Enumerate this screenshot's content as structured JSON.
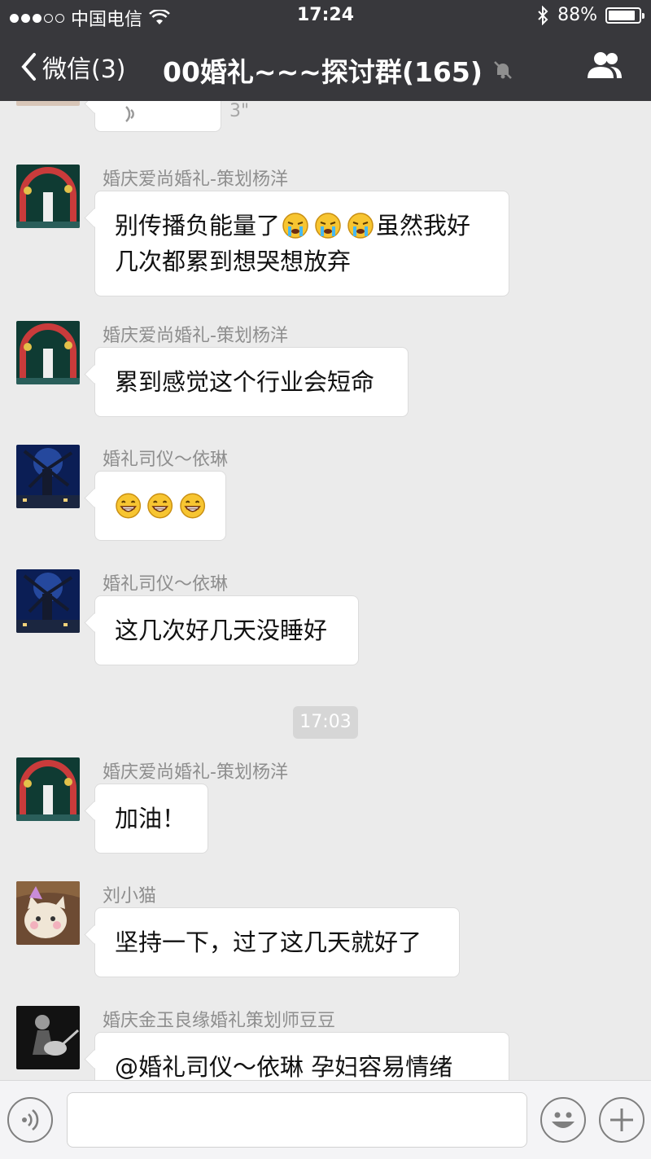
{
  "status": {
    "carrier": "中国电信",
    "time": "17:24",
    "battery": "88%",
    "battery_level": 0.88
  },
  "nav": {
    "back_label": "微信(3)",
    "title": "00婚礼~~~探讨群(165)"
  },
  "partial_voice_message": {
    "duration": "3\""
  },
  "messages": [
    {
      "sender": "婚庆爱尚婚礼-策划杨洋",
      "text_before": "别传播负能量了",
      "emoji": [
        "crying-face-icon",
        "crying-face-icon",
        "crying-face-icon"
      ],
      "text_after": "虽然我好",
      "line2": "几次都累到想哭想放弃"
    },
    {
      "sender": "婚庆爱尚婚礼-策划杨洋",
      "text": "累到感觉这个行业会短命"
    },
    {
      "sender": "婚礼司仪～依琳",
      "emoji": [
        "grinning-face-icon",
        "grinning-face-icon",
        "grinning-face-icon"
      ]
    },
    {
      "sender": "婚礼司仪～依琳",
      "text": "这几次好几天没睡好"
    },
    {
      "sender": "婚庆爱尚婚礼-策划杨洋",
      "text": "加油！"
    },
    {
      "sender": "刘小猫",
      "text": "坚持一下，过了这几天就好了"
    },
    {
      "sender": "婚庆金玉良缘婚礼策划师豆豆",
      "text": "@婚礼司仪～依琳 孕妇容易情绪"
    }
  ],
  "time_divider": "17:03",
  "colors": {
    "header_bg": "#38383c",
    "chat_bg": "#ebebeb",
    "bubble_bg": "#ffffff",
    "time_pill_bg": "#d6d6d6"
  }
}
